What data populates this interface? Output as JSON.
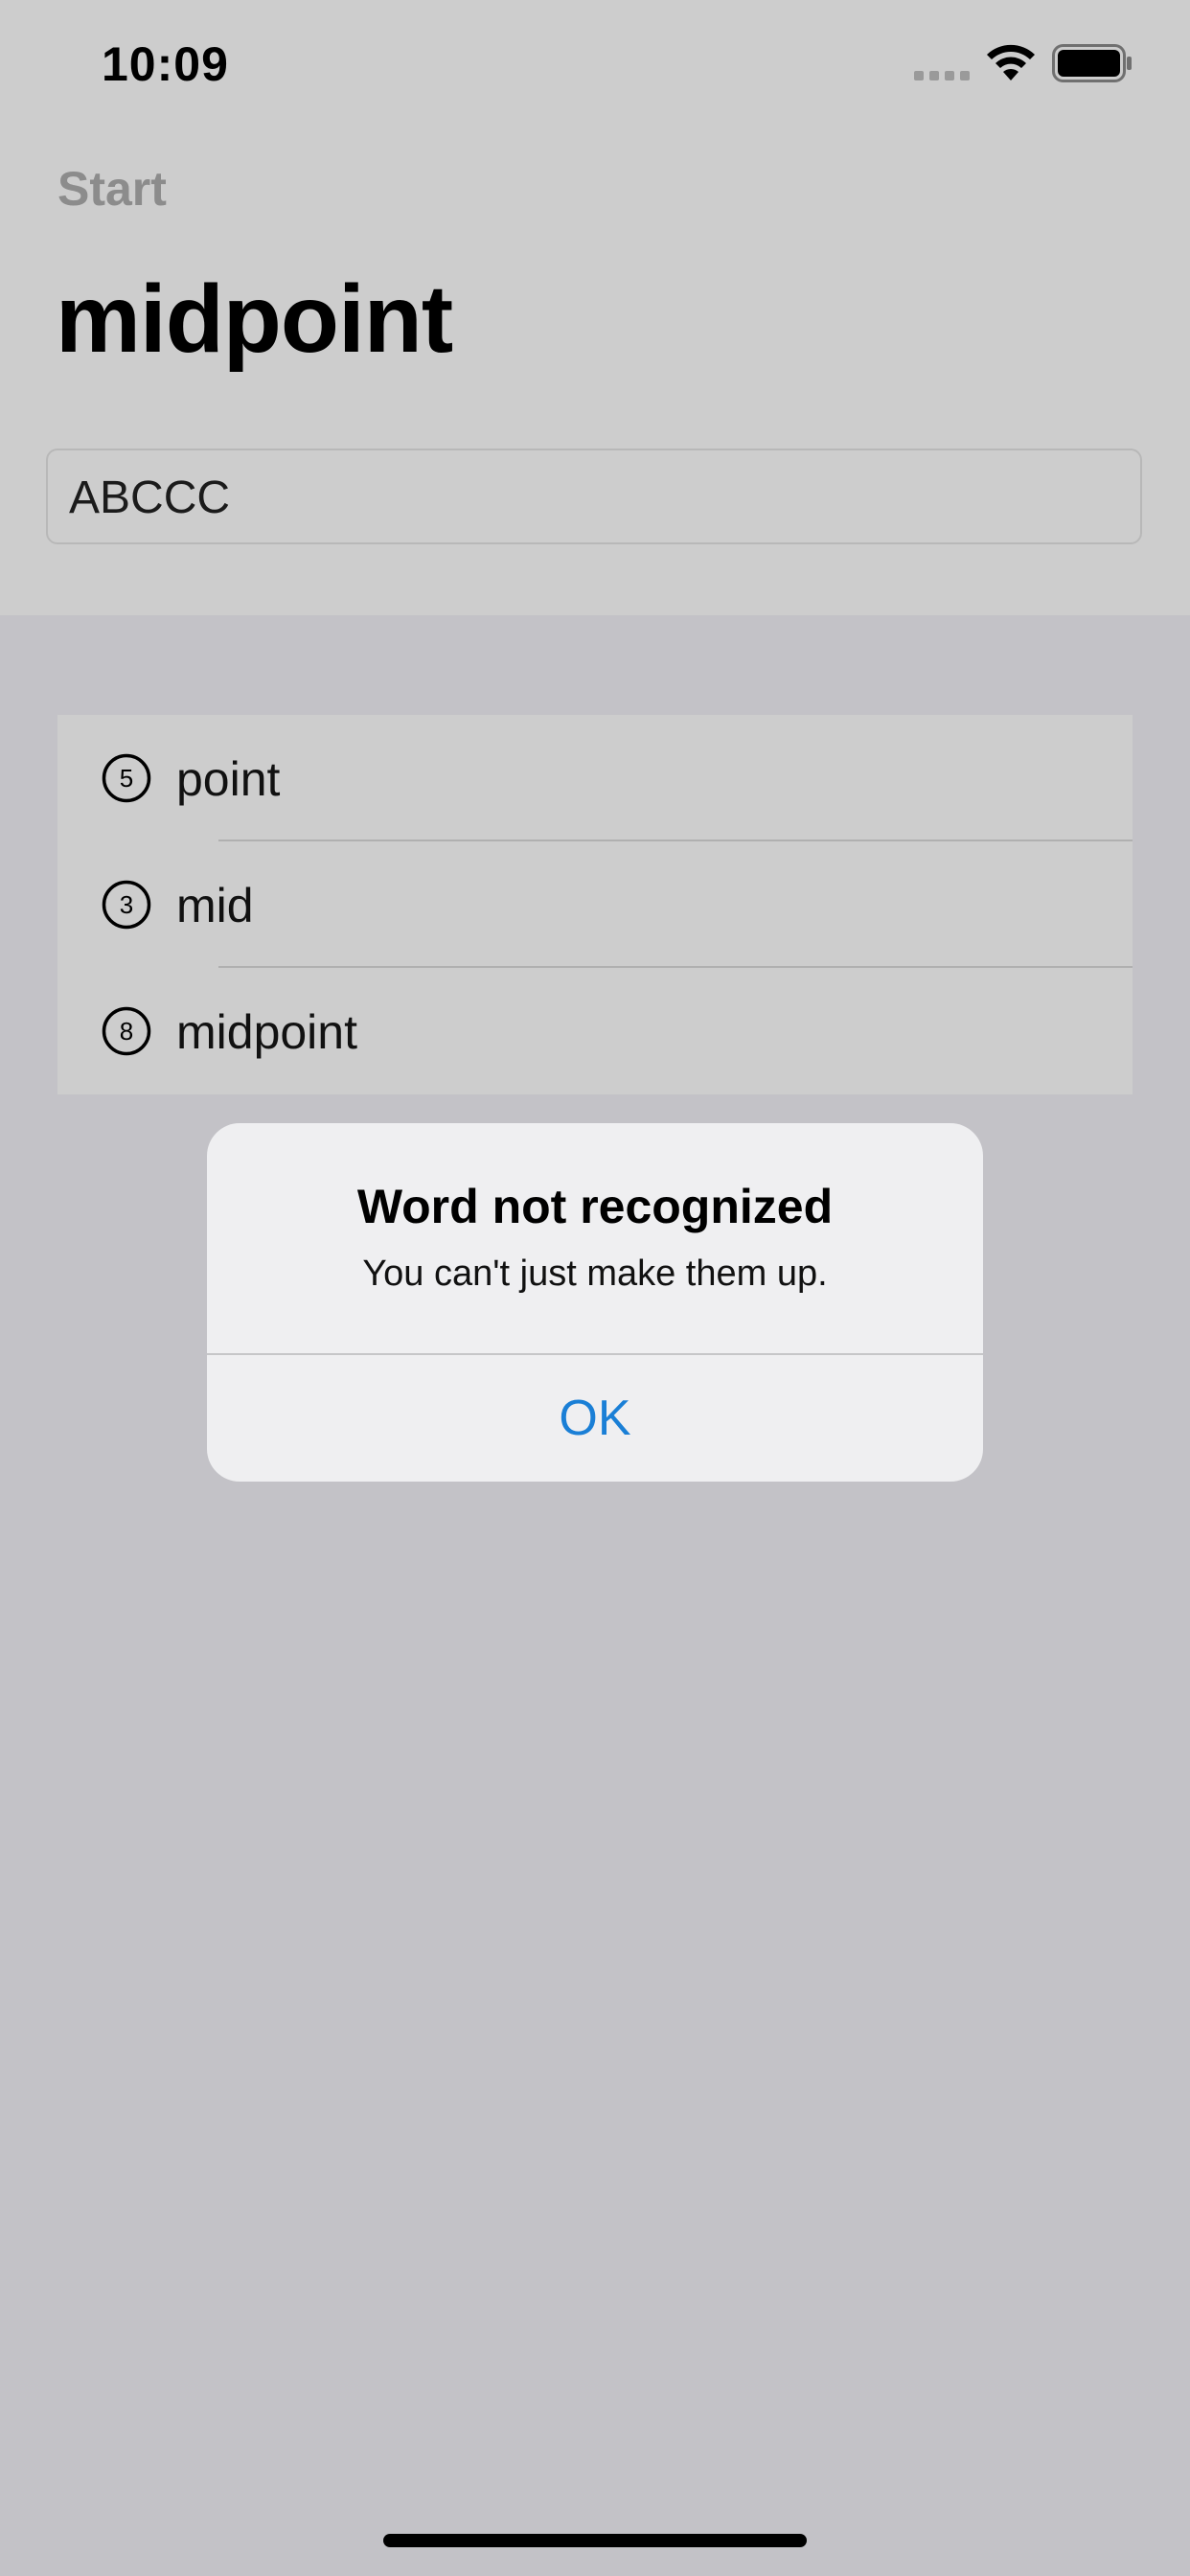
{
  "status_bar": {
    "time": "10:09",
    "icons": [
      "signal-icon",
      "wifi-icon",
      "battery-icon"
    ]
  },
  "nav": {
    "back_label": "Start",
    "title": "midpoint"
  },
  "input": {
    "value": "ABCCC"
  },
  "words": [
    {
      "count": "5",
      "word": "point"
    },
    {
      "count": "3",
      "word": "mid"
    },
    {
      "count": "8",
      "word": "midpoint"
    }
  ],
  "alert": {
    "title": "Word not recognized",
    "message": "You can't just make them up.",
    "ok_label": "OK"
  },
  "colors": {
    "background": "#c3c2c7",
    "header_background": "#cdcdcd",
    "alert_background": "#efeff1",
    "accent": "#1a7fd6"
  }
}
